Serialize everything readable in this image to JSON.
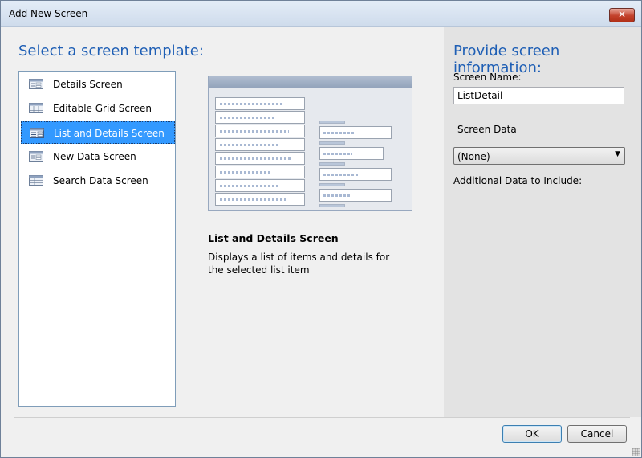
{
  "window": {
    "title": "Add New Screen",
    "close_glyph": "✕"
  },
  "left": {
    "heading": "Select a screen template:",
    "templates": [
      {
        "label": "Details Screen",
        "icon": "details-screen-icon",
        "selected": false
      },
      {
        "label": "Editable Grid Screen",
        "icon": "grid-screen-icon",
        "selected": false
      },
      {
        "label": "List and Details Screen",
        "icon": "list-details-screen-icon",
        "selected": true
      },
      {
        "label": "New Data Screen",
        "icon": "new-data-screen-icon",
        "selected": false
      },
      {
        "label": "Search Data Screen",
        "icon": "search-data-screen-icon",
        "selected": false
      }
    ],
    "preview_name": "List and Details Screen",
    "preview_description": "Displays a list of items and details for the selected list item"
  },
  "right": {
    "heading": "Provide screen information:",
    "screen_name_label": "Screen Name:",
    "screen_name_value": "ListDetail",
    "screen_data_label": "Screen Data",
    "screen_data_value": "(None)",
    "additional_label": "Additional Data to Include:"
  },
  "footer": {
    "ok_label": "OK",
    "cancel_label": "Cancel"
  },
  "colors": {
    "accent": "#1f5fb5",
    "selection": "#3399ff"
  }
}
